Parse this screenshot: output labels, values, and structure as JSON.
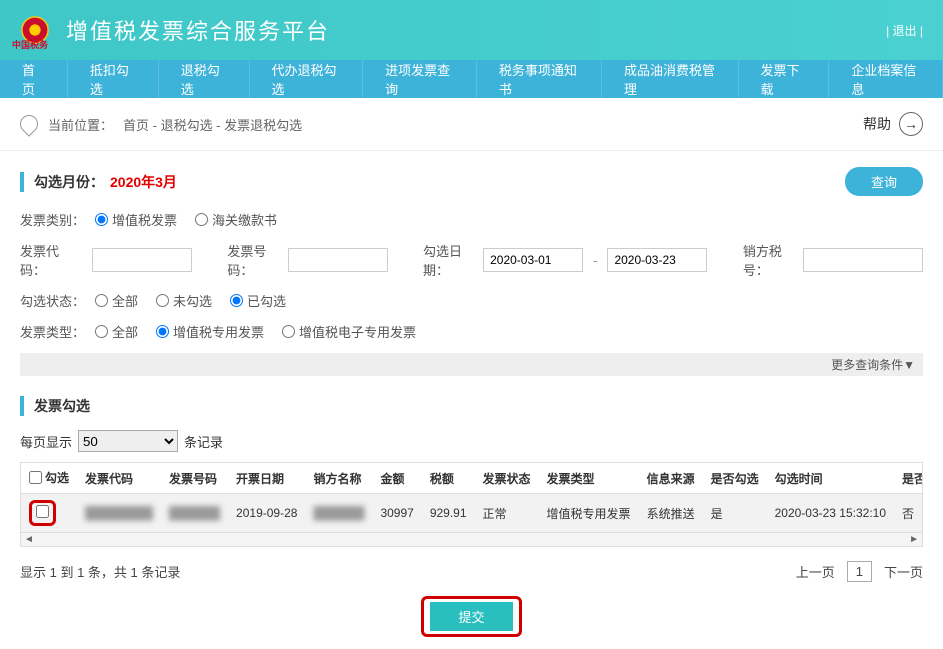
{
  "header": {
    "app_title": "增值税发票综合服务平台",
    "logout": "| 退出 |"
  },
  "nav": {
    "items": [
      "首页",
      "抵扣勾选",
      "退税勾选",
      "代办退税勾选",
      "进项发票查询",
      "税务事项通知书",
      "成品油消费税管理",
      "发票下载",
      "企业档案信息"
    ]
  },
  "breadcrumb": {
    "label": "当前位置：",
    "path": "首页 - 退税勾选 - 发票退税勾选",
    "help": "帮助"
  },
  "filter": {
    "title": "勾选月份：",
    "period": "2020年3月",
    "query_btn": "查询",
    "invoice_kind_label": "发票类别：",
    "invoice_kind_vat": "增值税发票",
    "invoice_kind_customs": "海关缴款书",
    "invoice_code_label": "发票代码：",
    "invoice_num_label": "发票号码：",
    "select_date_label": "勾选日期：",
    "date_from": "2020-03-01",
    "date_to": "2020-03-23",
    "seller_tax_label": "销方税号：",
    "select_status_label": "勾选状态：",
    "status_all": "全部",
    "status_unselected": "未勾选",
    "status_selected": "已勾选",
    "invoice_type_label": "发票类型：",
    "type_all": "全部",
    "type_special": "增值税专用发票",
    "type_e_special": "增值税电子专用发票",
    "more_filter": "更多查询条件▼"
  },
  "list": {
    "title": "发票勾选",
    "page_size_label_pre": "每页显示",
    "page_size_value": "50",
    "page_size_label_post": "条记录",
    "columns": [
      "勾选",
      "发票代码",
      "发票号码",
      "开票日期",
      "销方名称",
      "金额",
      "税额",
      "发票状态",
      "发票类型",
      "信息来源",
      "是否勾选",
      "勾选时间",
      "是否确认"
    ],
    "rows": [
      {
        "code": "████████",
        "num": "██████",
        "date": "2019-09-28",
        "seller": "██████",
        "amount": "30997",
        "tax": "929.91",
        "status": "正常",
        "type": "增值税专用发票",
        "source": "系统推送",
        "selected": "是",
        "select_time": "2020-03-23 15:32:10",
        "confirmed": "否"
      }
    ],
    "record_summary": "显示 1 到 1 条，共 1 条记录",
    "prev": "上一页",
    "page": "1",
    "next": "下一页",
    "submit": "提交"
  }
}
